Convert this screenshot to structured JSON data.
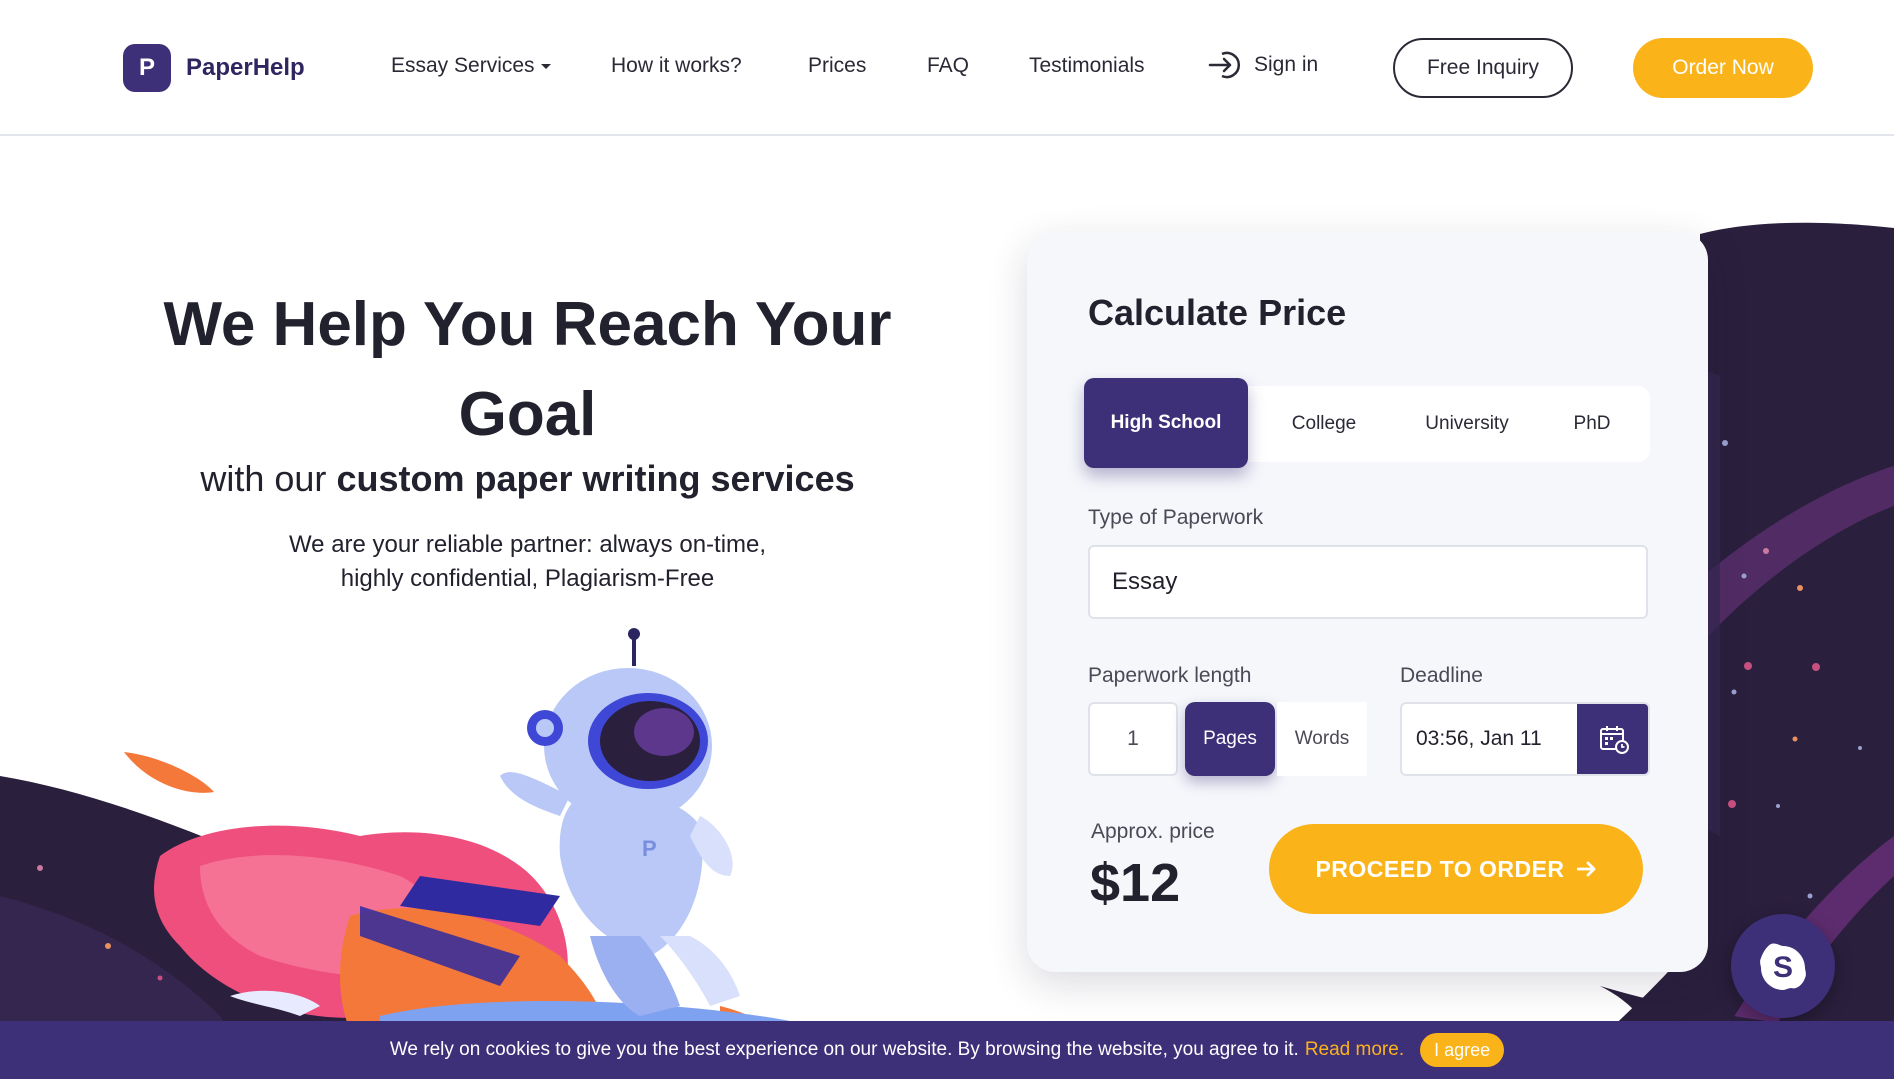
{
  "brand": {
    "logo_letter": "P",
    "name": "PaperHelp"
  },
  "nav": {
    "essay_services": "Essay Services",
    "how_it_works": "How it works?",
    "prices": "Prices",
    "faq": "FAQ",
    "testimonials": "Testimonials",
    "sign_in": "Sign in",
    "free_inquiry": "Free Inquiry",
    "order_now": "Order Now"
  },
  "hero": {
    "title_line1": "We Help You Reach Your",
    "title_line2": "Goal",
    "subtitle_prefix": "with our",
    "subtitle_bold": "custom paper writing services",
    "desc_line1": "We are your reliable partner: always on-time,",
    "desc_line2": "highly confidential, Plagiarism-Free"
  },
  "calculator": {
    "title": "Calculate Price",
    "levels": [
      "High School",
      "College",
      "University",
      "PhD"
    ],
    "active_level": "High School",
    "type_label": "Type of Paperwork",
    "type_value": "Essay",
    "length_label": "Paperwork length",
    "length_value": "1",
    "unit_pages": "Pages",
    "unit_words": "Words",
    "deadline_label": "Deadline",
    "deadline_value": "03:56, Jan 11",
    "approx_label": "Approx. price",
    "price": "$12",
    "proceed": "PROCEED TO ORDER"
  },
  "cookie": {
    "text": "We rely on cookies to give you the best experience on our website. By browsing the website, you agree to it.",
    "link": "Read more.",
    "button": "I agree"
  },
  "colors": {
    "brand_purple": "#3d2f78",
    "accent_yellow": "#fbb31a",
    "dark_space": "#2a1f3d"
  },
  "icons": [
    "sign-in-icon",
    "calendar-icon",
    "arrow-right-icon",
    "skype-icon",
    "chevron-down-icon"
  ]
}
